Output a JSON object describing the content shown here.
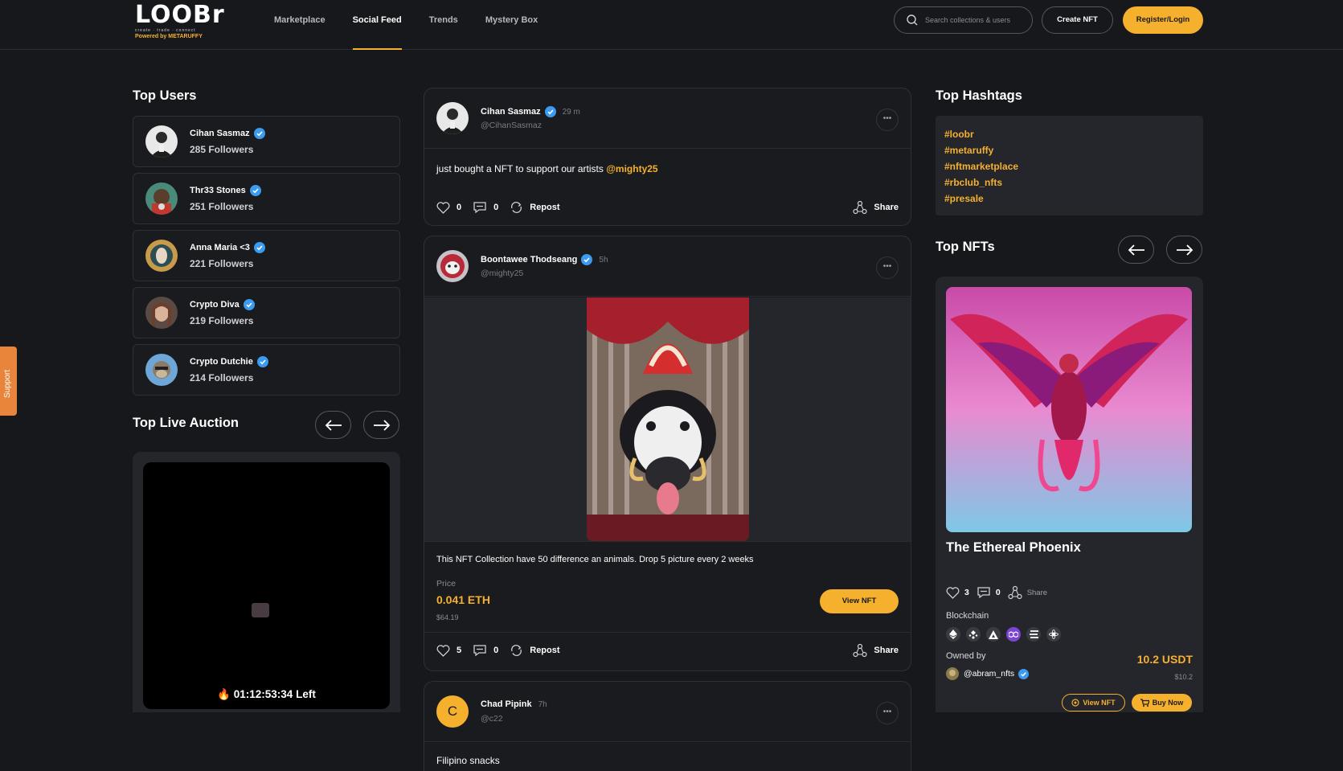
{
  "header": {
    "logo_text": "LOOBr",
    "logo_tagline": "create · trade · connect",
    "logo_powered": "Powered by METARUFFY",
    "nav": [
      "Marketplace",
      "Social Feed",
      "Trends",
      "Mystery Box"
    ],
    "active_nav": "Social Feed",
    "search_placeholder": "Search collections & users",
    "create_label": "Create NFT",
    "register_label": "Register/Login"
  },
  "support_label": "Support",
  "top_users": {
    "title": "Top Users",
    "users": [
      {
        "name": "Cihan Sasmaz",
        "followers": "285 Followers"
      },
      {
        "name": "Thr33 Stones",
        "followers": "251 Followers"
      },
      {
        "name": "Anna Maria <3",
        "followers": "221 Followers"
      },
      {
        "name": "Crypto Diva",
        "followers": "219 Followers"
      },
      {
        "name": "Crypto Dutchie",
        "followers": "214 Followers"
      }
    ]
  },
  "live_auction": {
    "title": "Top Live Auction",
    "timer": "01:12:53:34",
    "timer_suffix": "Left"
  },
  "feed": {
    "posts": [
      {
        "name": "Cihan Sasmaz",
        "time": "29 m",
        "handle": "@CihanSasmaz",
        "text": "just bought a NFT to support our artists ",
        "mention": "@mighty25",
        "likes": "0",
        "comments": "0",
        "repost": "Repost",
        "share": "Share"
      },
      {
        "name": "Boontawee Thodseang",
        "time": "5h",
        "handle": "@mighty25",
        "text": "This NFT Collection have 50 difference an animals. Drop 5 picture every 2 weeks",
        "price_label": "Price",
        "price": "0.041 ETH",
        "price_usd": "$64.19",
        "view_label": "View NFT",
        "likes": "5",
        "comments": "0",
        "repost": "Repost",
        "share": "Share"
      },
      {
        "name": "Chad Pipink",
        "time": "7h",
        "handle": "@c22",
        "avatar_letter": "C",
        "text": "Filipino snacks"
      }
    ]
  },
  "top_hashtags": {
    "title": "Top Hashtags",
    "tags": [
      "#loobr",
      "#metaruffy",
      "#nftmarketplace",
      "#rbclub_nfts",
      "#presale"
    ]
  },
  "top_nfts": {
    "title": "Top NFTs",
    "nft": {
      "name": "The Ethereal Phoenix",
      "likes": "3",
      "comments": "0",
      "share": "Share",
      "blockchain_label": "Blockchain",
      "owned_label": "Owned by",
      "owner": "@abram_nfts",
      "price": "10.2  USDT",
      "price_usd": "$10.2",
      "view_label": "View NFT",
      "buy_label": "Buy Now"
    }
  },
  "colors": {
    "accent": "#f5b02e",
    "background": "#17181c",
    "card": "#25262b",
    "verified": "#3b9bf0"
  }
}
